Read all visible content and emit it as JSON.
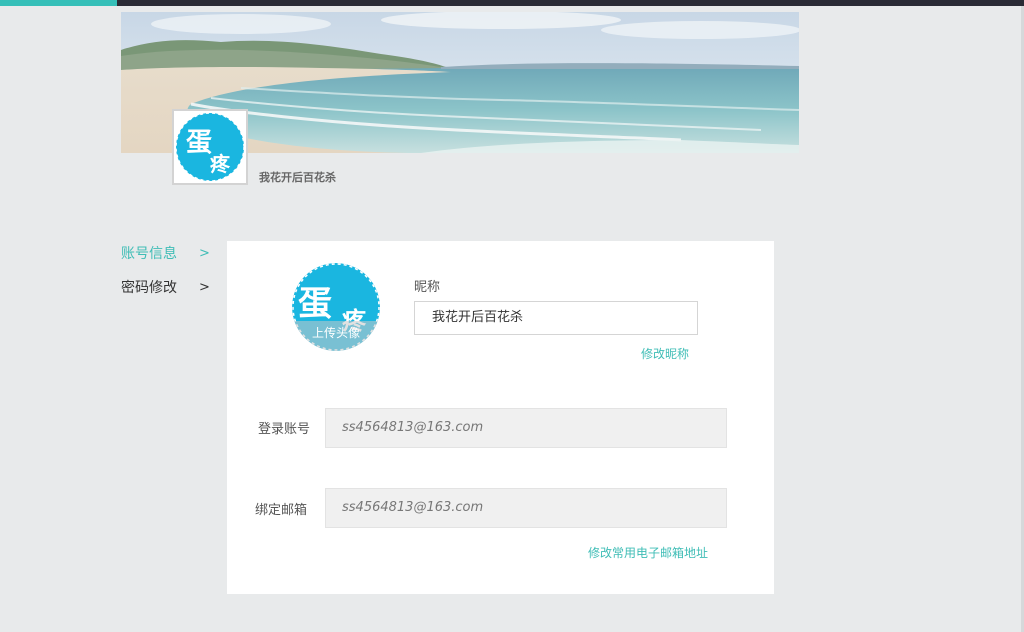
{
  "profile": {
    "name": "我花开后百花杀",
    "avatar_text_top": "蛋",
    "avatar_text_bottom": "疼"
  },
  "sidebar": {
    "items": [
      {
        "label": "账号信息",
        "arrow": ">",
        "active": true
      },
      {
        "label": "密码修改",
        "arrow": ">",
        "active": false
      }
    ]
  },
  "account_form": {
    "upload_avatar_label": "上传头像",
    "nickname_label": "昵称",
    "nickname_value": "我花开后百花杀",
    "edit_nickname_link": "修改昵称",
    "login_account_label": "登录账号",
    "login_account_value": "ss4564813@163.com",
    "bound_email_label": "绑定邮箱",
    "bound_email_value": "ss4564813@163.com",
    "edit_email_link": "修改常用电子邮箱地址"
  },
  "colors": {
    "accent": "#3fbdb6",
    "avatar_blue": "#1ab6e0",
    "top_bar": "#2a2b35",
    "page_bg": "#e8eaeb"
  }
}
